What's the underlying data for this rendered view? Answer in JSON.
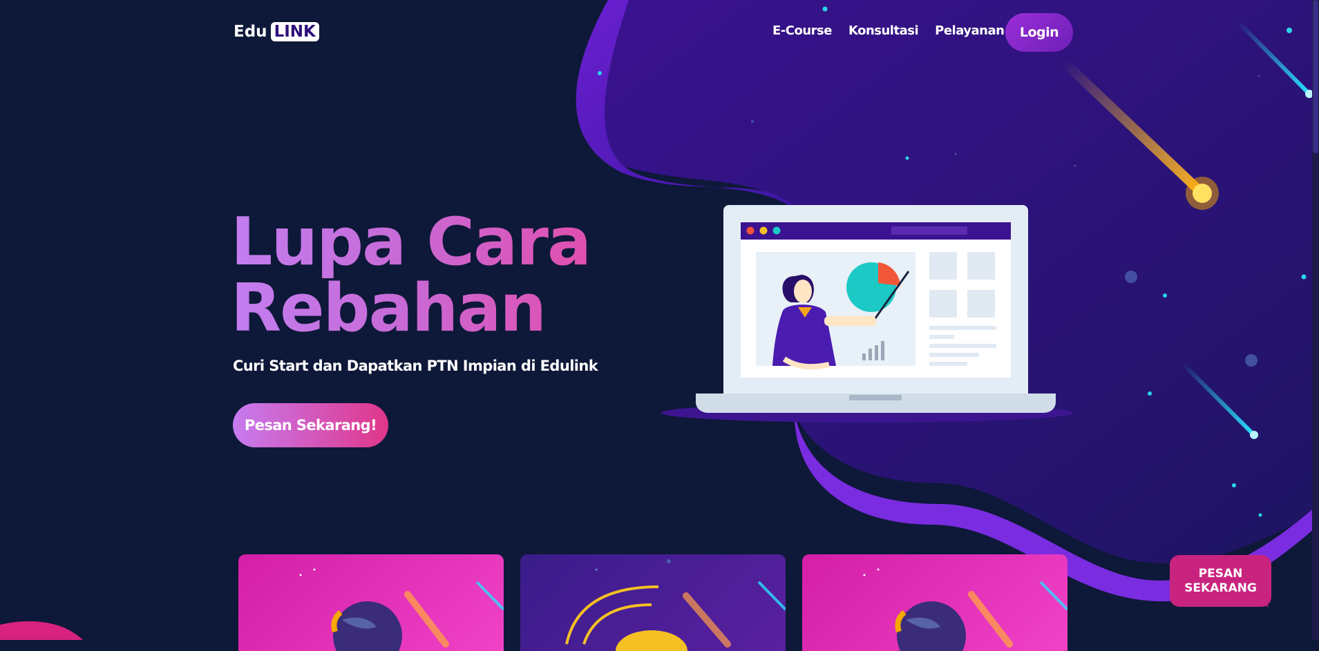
{
  "nav": {
    "logo_prefix": "Edu",
    "logo_suffix": "LINK",
    "links": [
      "E-Course",
      "Konsultasi",
      "Pelayanan"
    ],
    "login_label": "Login"
  },
  "hero": {
    "title_line1": "Lupa Cara",
    "title_line2": "Rebahan",
    "subtitle": "Curi Start dan Dapatkan PTN Impian di Edulink",
    "cta_label": "Pesan Sekarang!"
  },
  "floating_button": {
    "line1": "PESAN",
    "line2": "SEKARANG"
  },
  "colors": {
    "background": "#0e1838",
    "accent_purple": "#6a1fd0",
    "accent_pink": "#e0368a",
    "title_gradient_start": "#c27ef0",
    "title_gradient_end": "#e04fae"
  },
  "icons": [
    "laptop-illustration",
    "presenter-illustration",
    "pie-chart-icon",
    "comet-icon",
    "globe-icon"
  ]
}
